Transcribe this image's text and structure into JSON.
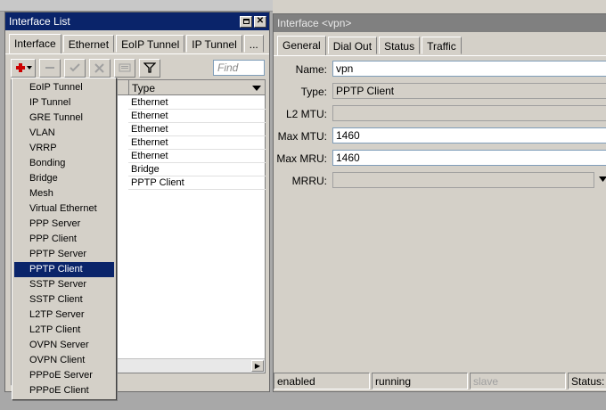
{
  "left_window": {
    "title": "Interface List",
    "tabs": [
      "Interface",
      "Ethernet",
      "EoIP Tunnel",
      "IP Tunnel",
      "..."
    ],
    "find_placeholder": "Find",
    "column_header": "Type",
    "rows": [
      "Ethernet",
      "Ethernet",
      "Ethernet",
      "Ethernet",
      "Ethernet",
      "Bridge",
      "PPTP Client"
    ]
  },
  "menu": {
    "items": [
      "EoIP Tunnel",
      "IP Tunnel",
      "GRE Tunnel",
      "VLAN",
      "VRRP",
      "Bonding",
      "Bridge",
      "Mesh",
      "Virtual Ethernet",
      "PPP Server",
      "PPP Client",
      "PPTP Server",
      "PPTP Client",
      "SSTP Server",
      "SSTP Client",
      "L2TP Server",
      "L2TP Client",
      "OVPN Server",
      "OVPN Client",
      "PPPoE Server",
      "PPPoE Client"
    ],
    "selected": "PPTP Client"
  },
  "right_window": {
    "title": "Interface <vpn>",
    "tabs": [
      "General",
      "Dial Out",
      "Status",
      "Traffic"
    ],
    "fields": {
      "name": {
        "label": "Name:",
        "value": "vpn"
      },
      "type": {
        "label": "Type:",
        "value": "PPTP Client"
      },
      "l2mtu": {
        "label": "L2 MTU:",
        "value": ""
      },
      "maxmtu": {
        "label": "Max MTU:",
        "value": "1460"
      },
      "maxmru": {
        "label": "Max MRU:",
        "value": "1460"
      },
      "mrru": {
        "label": "MRRU:",
        "value": ""
      }
    },
    "status": [
      "enabled",
      "running",
      "slave",
      "Status: c"
    ]
  },
  "colors": {
    "title_active": "#0a246a",
    "title_inactive": "#808080",
    "face": "#d4d0c8",
    "selection": "#0a246a",
    "add_red": "#cc0000"
  }
}
